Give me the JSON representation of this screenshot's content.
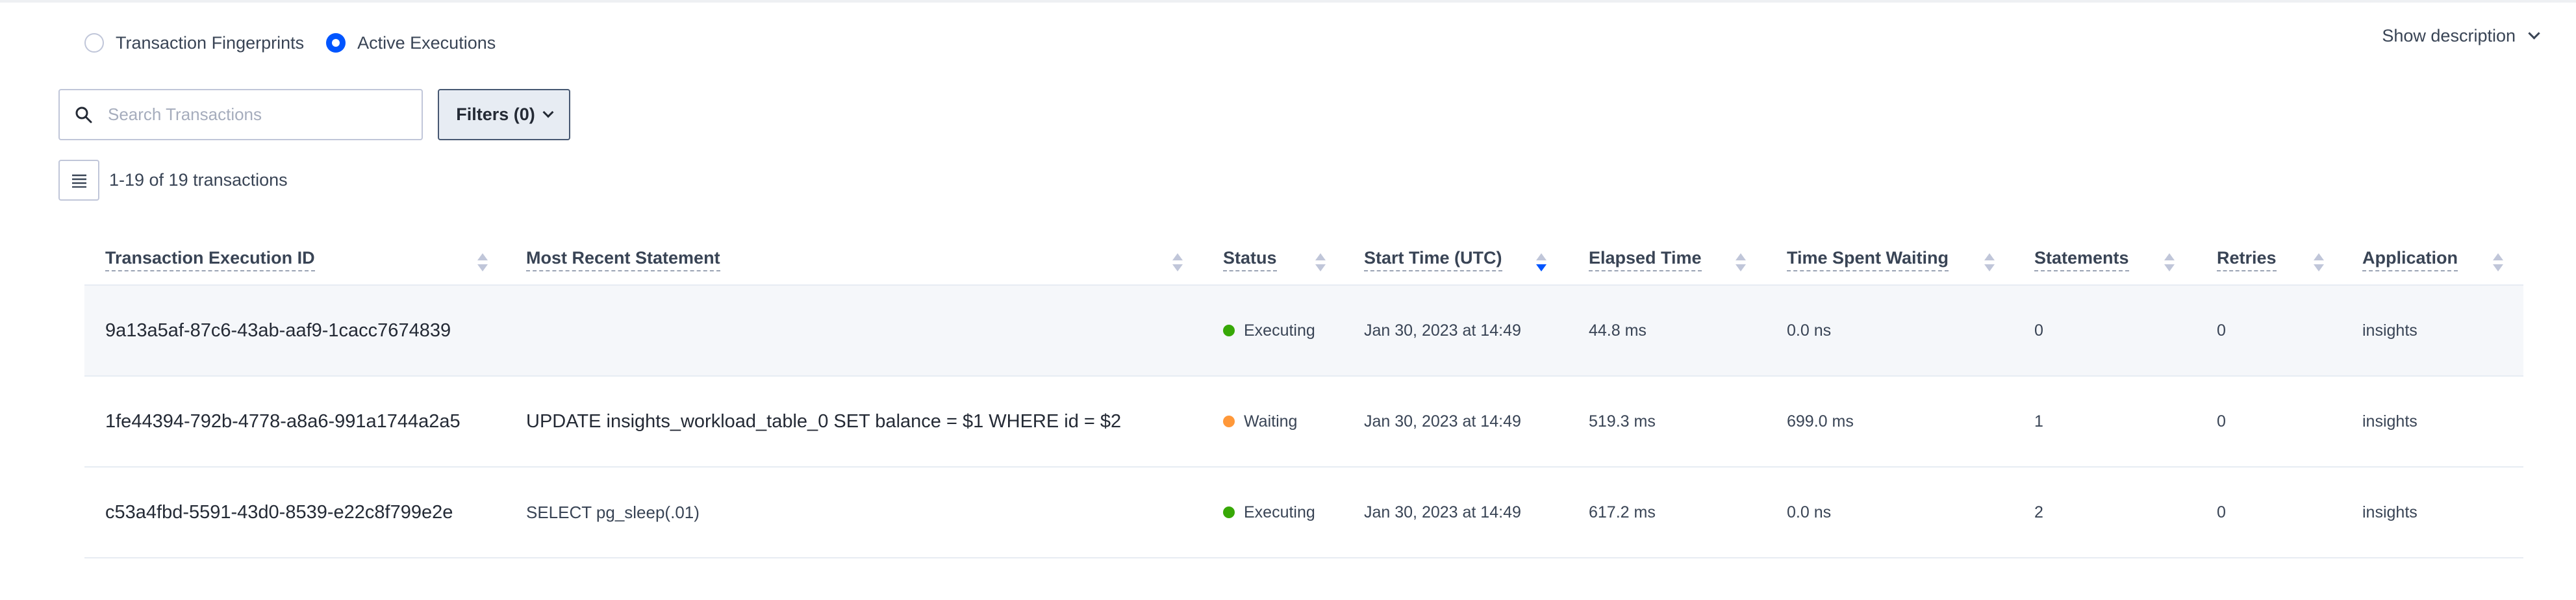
{
  "view_switch": {
    "options": [
      {
        "label": "Transaction Fingerprints",
        "selected": false
      },
      {
        "label": "Active Executions",
        "selected": true
      }
    ]
  },
  "show_description": "Show description",
  "search": {
    "placeholder": "Search Transactions",
    "value": ""
  },
  "filters_label": "Filters (0)",
  "result_count": "1-19 of 19 transactions",
  "columns": [
    {
      "label": "Transaction Execution ID",
      "sorted": false
    },
    {
      "label": "Most Recent Statement",
      "sorted": false
    },
    {
      "label": "Status",
      "sorted": false
    },
    {
      "label": "Start Time (UTC)",
      "sorted": "descending"
    },
    {
      "label": "Elapsed Time",
      "sorted": false
    },
    {
      "label": "Time Spent Waiting",
      "sorted": false
    },
    {
      "label": "Statements",
      "sorted": false
    },
    {
      "label": "Retries",
      "sorted": false
    },
    {
      "label": "Application",
      "sorted": false
    }
  ],
  "status_colors": {
    "Executing": "#37a806",
    "Waiting": "#ff9839"
  },
  "rows": [
    {
      "id": "9a13a5af-87c6-43ab-aaf9-1cacc7674839",
      "statement": "",
      "status": "Executing",
      "start_time": "Jan 30, 2023 at 14:49",
      "elapsed": "44.8 ms",
      "waiting": "0.0 ns",
      "statements": "0",
      "retries": "0",
      "application": "insights"
    },
    {
      "id": "1fe44394-792b-4778-a8a6-991a1744a2a5",
      "statement": "UPDATE insights_workload_table_0 SET balance = $1 WHERE id = $2",
      "status": "Waiting",
      "start_time": "Jan 30, 2023 at 14:49",
      "elapsed": "519.3 ms",
      "waiting": "699.0 ms",
      "statements": "1",
      "retries": "0",
      "application": "insights"
    },
    {
      "id": "c53a4fbd-5591-43d0-8539-e22c8f799e2e",
      "statement": "SELECT pg_sleep(.01)",
      "status": "Executing",
      "start_time": "Jan 30, 2023 at 14:49",
      "elapsed": "617.2 ms",
      "waiting": "0.0 ns",
      "statements": "2",
      "retries": "0",
      "application": "insights"
    }
  ]
}
